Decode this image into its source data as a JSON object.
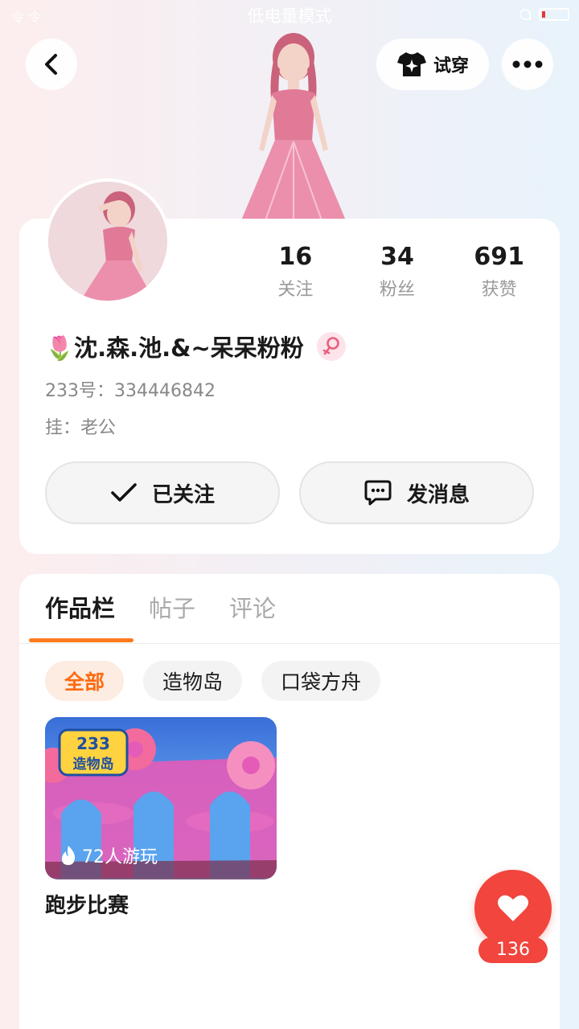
{
  "status_bar": {
    "left": "令 令",
    "center": "低电量模式"
  },
  "header": {
    "try_on_label": "试穿"
  },
  "stats": [
    {
      "value": "16",
      "label": "关注"
    },
    {
      "value": "34",
      "label": "粉丝"
    },
    {
      "value": "691",
      "label": "获赞"
    }
  ],
  "profile": {
    "username": "🌷沈.森.池.&~呆呆粉粉",
    "gender_symbol": "♀",
    "uid": "233号：334446842",
    "tag": "挂：老公"
  },
  "actions": {
    "followed_label": "已关注",
    "message_label": "发消息"
  },
  "tabs": [
    "作品栏",
    "帖子",
    "评论"
  ],
  "filters": [
    "全部",
    "造物岛",
    "口袋方舟"
  ],
  "games": [
    {
      "title": "跑步比赛",
      "players": "72人游玩",
      "badge_top": "233",
      "badge_bottom": "造物岛"
    }
  ],
  "like": {
    "count": "136"
  },
  "colors": {
    "accent_orange": "#ff7a1f",
    "like_red": "#f1453d",
    "gender_pink": "#e8607e"
  }
}
